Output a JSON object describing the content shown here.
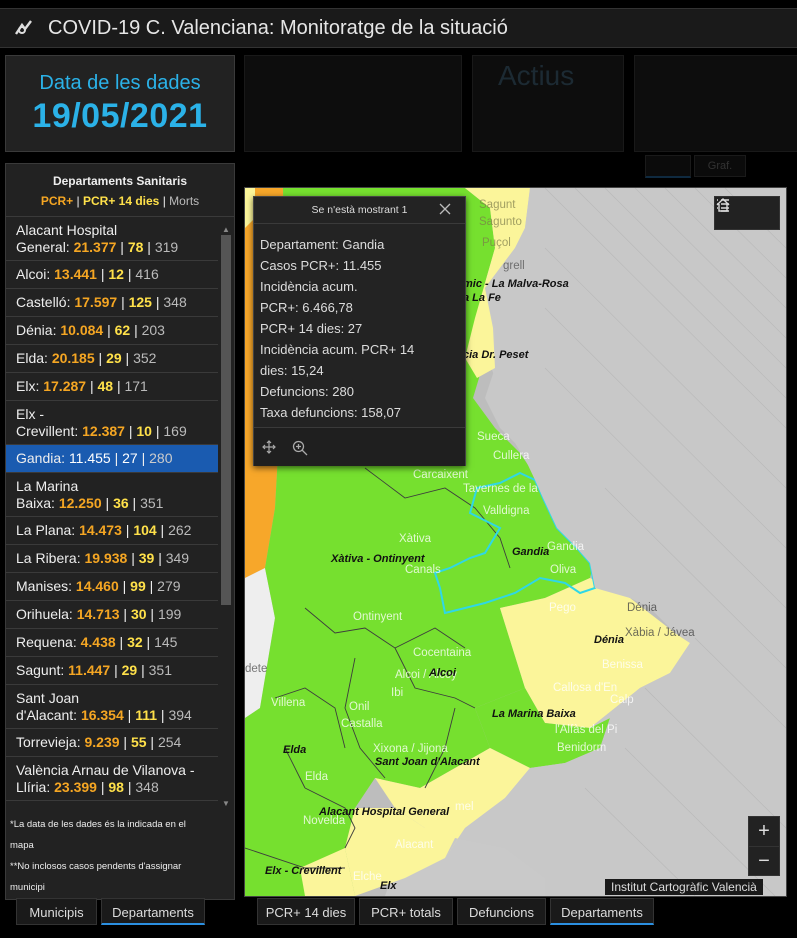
{
  "app": {
    "title": "COVID-19 C. Valenciana: Monitoratge de la situació"
  },
  "date_panel": {
    "label": "Data de les dades",
    "value": "19/05/2021"
  },
  "list": {
    "heading": "Departaments Sanitaris",
    "legend": {
      "a": "PCR+",
      "sep1": " | ",
      "b": "PCR+ 14 dies",
      "sep2": " | ",
      "c": "Morts"
    },
    "items": [
      {
        "name": "Alacant Hospital",
        "name2": "General:",
        "pcr": "21.377",
        "d14": "78",
        "morts": "319",
        "selected": false
      },
      {
        "name": "Alcoi:",
        "name2": "",
        "pcr": "13.441",
        "d14": "12",
        "morts": "416",
        "selected": false
      },
      {
        "name": "Castelló:",
        "name2": "",
        "pcr": "17.597",
        "d14": "125",
        "morts": "348",
        "selected": false
      },
      {
        "name": "Dénia:",
        "name2": "",
        "pcr": "10.084",
        "d14": "62",
        "morts": "203",
        "selected": false
      },
      {
        "name": "Elda:",
        "name2": "",
        "pcr": "20.185",
        "d14": "29",
        "morts": "352",
        "selected": false
      },
      {
        "name": "Elx:",
        "name2": "",
        "pcr": "17.287",
        "d14": "48",
        "morts": "171",
        "selected": false
      },
      {
        "name": "Elx -",
        "name2": "Crevillent:",
        "pcr": "12.387",
        "d14": "10",
        "morts": "169",
        "selected": false
      },
      {
        "name": "Gandia:",
        "name2": "",
        "pcr": "11.455",
        "d14": "27",
        "morts": "280",
        "selected": true
      },
      {
        "name": "La Marina",
        "name2": "Baixa:",
        "pcr": "12.250",
        "d14": "36",
        "morts": "351",
        "selected": false
      },
      {
        "name": "La Plana:",
        "name2": "",
        "pcr": "14.473",
        "d14": "104",
        "morts": "262",
        "selected": false
      },
      {
        "name": "La Ribera:",
        "name2": "",
        "pcr": "19.938",
        "d14": "39",
        "morts": "349",
        "selected": false
      },
      {
        "name": "Manises:",
        "name2": "",
        "pcr": "14.460",
        "d14": "99",
        "morts": "279",
        "selected": false
      },
      {
        "name": "Orihuela:",
        "name2": "",
        "pcr": "14.713",
        "d14": "30",
        "morts": "199",
        "selected": false
      },
      {
        "name": "Requena:",
        "name2": "",
        "pcr": "4.438",
        "d14": "32",
        "morts": "145",
        "selected": false
      },
      {
        "name": "Sagunt:",
        "name2": "",
        "pcr": "11.447",
        "d14": "29",
        "morts": "351",
        "selected": false
      },
      {
        "name": "Sant Joan",
        "name2": "d'Alacant:",
        "pcr": "16.354",
        "d14": "111",
        "morts": "394",
        "selected": false
      },
      {
        "name": "Torrevieja:",
        "name2": "",
        "pcr": "9.239",
        "d14": "55",
        "morts": "254",
        "selected": false
      },
      {
        "name": "València Arnau de Vilanova -",
        "name2": "Llíria:",
        "pcr": "23.399",
        "d14": "98",
        "morts": "348",
        "selected": false
      }
    ],
    "notes": [
      "*La data de les dades és la indicada en el",
      "mapa",
      "**No inclosos casos pendents d'assignar",
      "municipi"
    ]
  },
  "left_tabs": [
    {
      "label": "Municipis",
      "active": false
    },
    {
      "label": "Departaments",
      "active": true
    }
  ],
  "map_tabs": [
    {
      "label": "PCR+ 14 dies",
      "active": false
    },
    {
      "label": "PCR+ totals",
      "active": false
    },
    {
      "label": "Defuncions",
      "active": false
    },
    {
      "label": "Departaments",
      "active": true
    }
  ],
  "ghost": {
    "title": "Actius",
    "tab2": "Graf."
  },
  "popup": {
    "header": "Se n'està mostrant 1",
    "lines": [
      "Departament: Gandia",
      "Casos PCR+: 11.455",
      "Incidència acum.",
      "PCR+: 6.466,78",
      "PCR+ 14 dies: 27",
      "Incidència acum. PCR+ 14",
      "dies: 15,24",
      "Defuncions: 280",
      "Taxa defuncions: 158,07"
    ]
  },
  "map": {
    "attribution": "Institut Cartogràfic Valencià",
    "zoom_in": "+",
    "zoom_out": "−",
    "colors": {
      "green": "#76e02f",
      "yellow": "#fbf59a",
      "orange": "#f7a72a",
      "highlight": "#2fd7e6",
      "sea": "#c8c8c8"
    },
    "places": {
      "sagunt": "Sagunt",
      "sagunto": "Sagunto",
      "pucol": "Puçol",
      "grell": "grell",
      "malvarosa": "mic - La Malva-Rosa",
      "lafe": "a La Fe",
      "peset": "cia Dr. Peset",
      "sueca": "Sueca",
      "cullera": "Cullera",
      "carcaixent": "Carcaixent",
      "tavernes": "Tavernes de la",
      "valldigna": "Valldigna",
      "xativa": "Xàtiva",
      "canals": "Canals",
      "gandia_town": "Gandia",
      "oliva": "Oliva",
      "pego": "Pego",
      "denia_town": "Dénia",
      "xabia": "Xàbia / Jávea",
      "benissa": "Benissa",
      "calp": "Calp",
      "callosa": "Callosa d'En",
      "alfas": "l'Alfàs del Pi",
      "benidorm": "Benidorm",
      "ontinyent": "Ontinyent",
      "cocentaina": "Cocentaina",
      "alcoi_town": "Alcoi / Alcoy",
      "villena": "Villena",
      "onil": "Onil",
      "castalla": "Castalla",
      "ibi": "Ibi",
      "elda_town": "Elda",
      "xixona": "Xixona / Jijona",
      "novelda": "Novelda",
      "alacant": "Alacant",
      "elche": "Elche",
      "mel": "mel",
      "dete": "dete"
    },
    "departments": {
      "xativa": "Xàtiva - Ontinyent",
      "gandia": "Gandia",
      "denia": "Dénia",
      "alcoi": "Alcoi",
      "marina": "La Marina Baixa",
      "elda": "Elda",
      "santjoan": "Sant Joan d'Alacant",
      "alacant": "Alacant Hospital General",
      "elxcrev": "Elx - Crevillent",
      "elx": "Elx"
    }
  }
}
